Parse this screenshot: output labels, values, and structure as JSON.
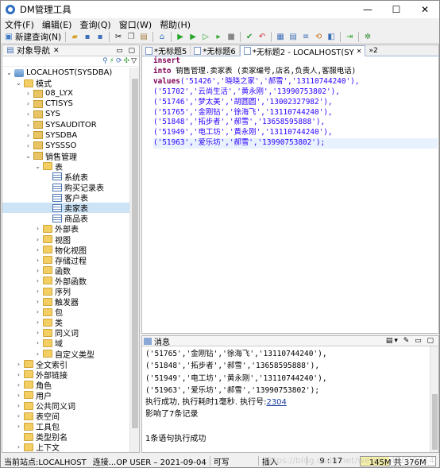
{
  "window": {
    "title": "DM管理工具",
    "min": "—",
    "max": "☐",
    "close": "✕"
  },
  "menu": [
    "文件(F)",
    "编辑(E)",
    "查询(Q)",
    "窗口(W)",
    "帮助(H)"
  ],
  "toolbar": {
    "new_query_label": "新建查询(N)"
  },
  "left_panel": {
    "title": "对象导航",
    "tree": [
      {
        "depth": 0,
        "twisty": "⌄",
        "icon": "db",
        "label": "LOCALHOST(SYSDBA)"
      },
      {
        "depth": 1,
        "twisty": "⌄",
        "icon": "fld",
        "label": "模式"
      },
      {
        "depth": 2,
        "twisty": "›",
        "icon": "sch",
        "label": "08_LYX"
      },
      {
        "depth": 2,
        "twisty": "›",
        "icon": "sch",
        "label": "CTISYS"
      },
      {
        "depth": 2,
        "twisty": "›",
        "icon": "sch",
        "label": "SYS"
      },
      {
        "depth": 2,
        "twisty": "›",
        "icon": "sch",
        "label": "SYSAUDITOR"
      },
      {
        "depth": 2,
        "twisty": "›",
        "icon": "sch",
        "label": "SYSDBA"
      },
      {
        "depth": 2,
        "twisty": "›",
        "icon": "sch",
        "label": "SYSSSO"
      },
      {
        "depth": 2,
        "twisty": "⌄",
        "icon": "sch",
        "label": "销售管理"
      },
      {
        "depth": 3,
        "twisty": "⌄",
        "icon": "fld",
        "label": "表"
      },
      {
        "depth": 4,
        "twisty": "",
        "icon": "tbl",
        "label": "系统表"
      },
      {
        "depth": 4,
        "twisty": "",
        "icon": "tbl",
        "label": "购买记录表"
      },
      {
        "depth": 4,
        "twisty": "",
        "icon": "tbl",
        "label": "客户表"
      },
      {
        "depth": 4,
        "twisty": "",
        "icon": "tbl",
        "label": "卖家表",
        "selected": true
      },
      {
        "depth": 4,
        "twisty": "",
        "icon": "tbl",
        "label": "商品表"
      },
      {
        "depth": 3,
        "twisty": "›",
        "icon": "fld",
        "label": "外部表"
      },
      {
        "depth": 3,
        "twisty": "›",
        "icon": "fld",
        "label": "视图"
      },
      {
        "depth": 3,
        "twisty": "›",
        "icon": "fld",
        "label": "物化视图"
      },
      {
        "depth": 3,
        "twisty": "›",
        "icon": "fld",
        "label": "存储过程"
      },
      {
        "depth": 3,
        "twisty": "›",
        "icon": "fld",
        "label": "函数"
      },
      {
        "depth": 3,
        "twisty": "›",
        "icon": "fld",
        "label": "外部函数"
      },
      {
        "depth": 3,
        "twisty": "›",
        "icon": "fld",
        "label": "序列"
      },
      {
        "depth": 3,
        "twisty": "›",
        "icon": "fld",
        "label": "触发器"
      },
      {
        "depth": 3,
        "twisty": "›",
        "icon": "fld",
        "label": "包"
      },
      {
        "depth": 3,
        "twisty": "›",
        "icon": "fld",
        "label": "类"
      },
      {
        "depth": 3,
        "twisty": "›",
        "icon": "fld",
        "label": "同义词"
      },
      {
        "depth": 3,
        "twisty": "›",
        "icon": "fld",
        "label": "域"
      },
      {
        "depth": 3,
        "twisty": "›",
        "icon": "fld",
        "label": "自定义类型"
      },
      {
        "depth": 1,
        "twisty": "›",
        "icon": "fld",
        "label": "全文索引"
      },
      {
        "depth": 1,
        "twisty": "›",
        "icon": "fld",
        "label": "外部链接"
      },
      {
        "depth": 1,
        "twisty": "›",
        "icon": "fld",
        "label": "角色"
      },
      {
        "depth": 1,
        "twisty": "›",
        "icon": "fld",
        "label": "用户"
      },
      {
        "depth": 1,
        "twisty": "›",
        "icon": "fld",
        "label": "公共同义词"
      },
      {
        "depth": 1,
        "twisty": "›",
        "icon": "fld",
        "label": "表空间"
      },
      {
        "depth": 1,
        "twisty": "›",
        "icon": "fld",
        "label": "工具包"
      },
      {
        "depth": 1,
        "twisty": "",
        "icon": "fld",
        "label": "类型别名"
      },
      {
        "depth": 1,
        "twisty": "›",
        "icon": "fld",
        "label": "上下文"
      }
    ]
  },
  "editor": {
    "tabs": [
      {
        "label": "*无标题5",
        "active": false
      },
      {
        "label": "*无标题6",
        "active": false
      },
      {
        "label": "*无标题2 - LOCALHOST(SY",
        "active": true
      }
    ],
    "more_tabs": "»2",
    "lines": [
      [
        {
          "t": "insert",
          "c": "kw"
        }
      ],
      [
        {
          "t": "into",
          "c": "kw"
        },
        {
          "t": " 销售管理.卖家表 (卖家编号,店名,负责人,客服电话)",
          "c": ""
        }
      ],
      [
        {
          "t": "values",
          "c": "kw"
        },
        {
          "t": "('51426','晓晓之家','郝雪','13110744240'),",
          "c": "str"
        }
      ],
      [
        {
          "t": "('51702','云尚生活','黄永刚','13990753802'),",
          "c": "str"
        }
      ],
      [
        {
          "t": "('51746','梦太美','胡圆圆','13002327982'),",
          "c": "str"
        }
      ],
      [
        {
          "t": "('51765','金刚钻','徐海飞','13110744240'),",
          "c": "str"
        }
      ],
      [
        {
          "t": "('51848','拓步者','郝雪','13658595888'),",
          "c": "str"
        }
      ],
      [
        {
          "t": "('51949','电工坊','黄永刚','13110744240'),",
          "c": "str"
        }
      ],
      [
        {
          "t": "('51963','爱乐坊','郝雪','13990753802');",
          "c": "str",
          "current": true
        }
      ]
    ]
  },
  "messages": {
    "title": "消息",
    "lines": [
      {
        "kind": "m",
        "text": "('51765','金刚钻','徐海飞','13110744240'),"
      },
      {
        "kind": "m",
        "text": "('51848','拓步者','郝雪','13658595888'),"
      },
      {
        "kind": "m",
        "text": "('51949','电工坊','黄永刚','13110744240'),"
      },
      {
        "kind": "m",
        "text": "('51963','爱乐坊','郝雪','13990753802');"
      },
      {
        "kind": "exec",
        "text": "执行成功, 执行耗时1毫秒. 执行号:",
        "link": "2304"
      },
      {
        "kind": "t",
        "text": "影响了7条记录"
      },
      {
        "kind": "t",
        "text": ""
      },
      {
        "kind": "t",
        "text": "1条语句执行成功"
      }
    ]
  },
  "status": {
    "site": "当前站点:LOCALHOST",
    "conn": "连接...OP USER – 2021-09-04",
    "writable": "可写",
    "mode": "插入",
    "pos": "9 : 17",
    "memory": "145M 共 376M",
    "memory_fraction": 0.386
  },
  "watermark": "https://blog.csdn.net/weixin_47600914"
}
